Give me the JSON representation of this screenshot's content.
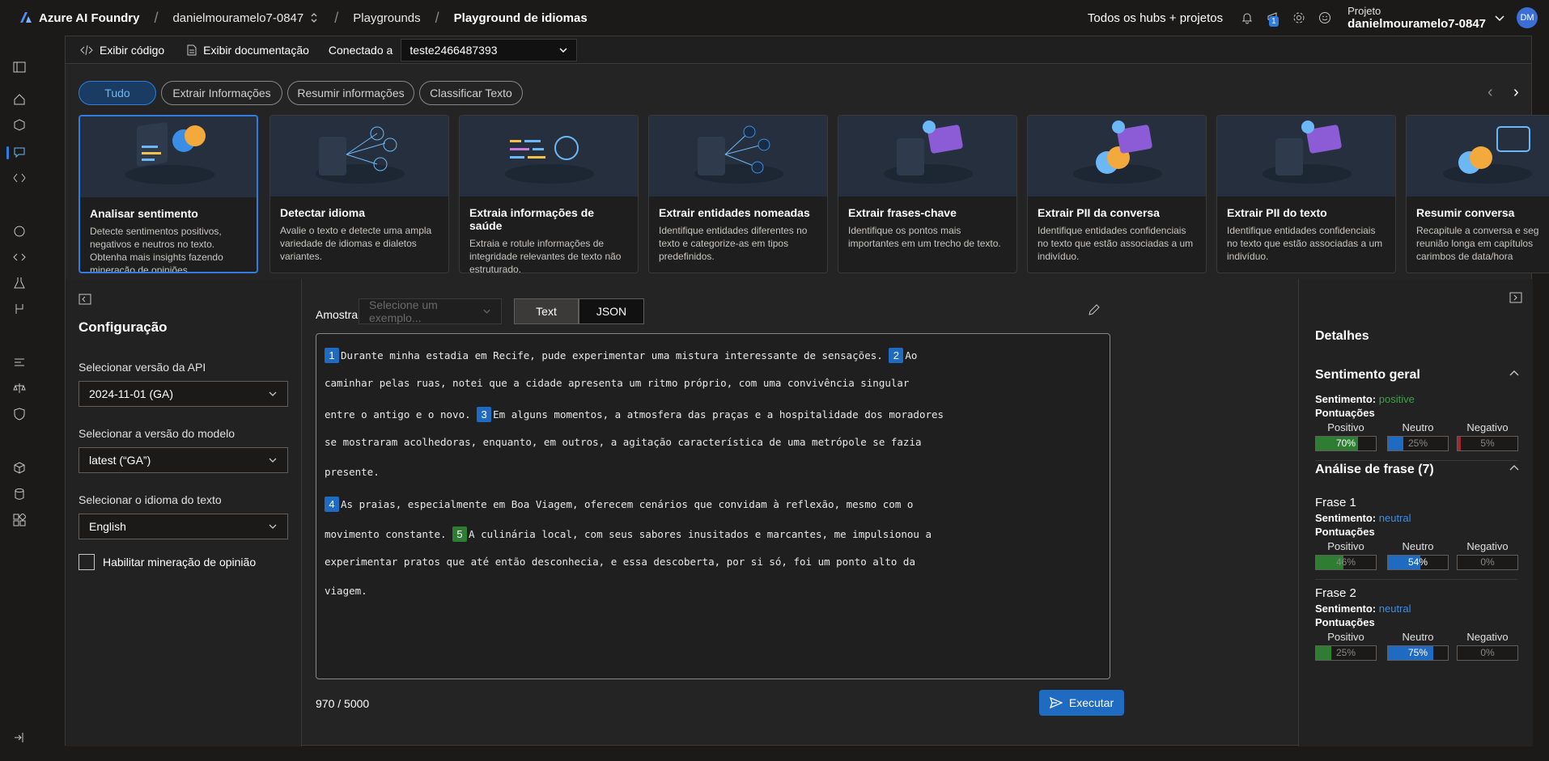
{
  "topbar": {
    "app_name": "Azure AI Foundry",
    "breadcrumb_project": "danielmouramelo7-0847",
    "breadcrumb_playgrounds": "Playgrounds",
    "breadcrumb_current": "Playground de idiomas",
    "all_hubs": "Todos os hubs + projetos",
    "notification_count": "1",
    "project_label": "Projeto",
    "project_name": "danielmouramelo7-0847",
    "avatar_initials": "DM"
  },
  "toolbar": {
    "view_code": "Exibir código",
    "view_docs": "Exibir documentação",
    "connected_to": "Conectado a",
    "connection": "teste2466487393"
  },
  "filters": [
    "Tudo",
    "Extrair Informações",
    "Resumir informações",
    "Classificar Texto"
  ],
  "cards": [
    {
      "title": "Analisar sentimento",
      "desc": "Detecte sentimentos positivos, negativos e neutros no texto. Obtenha mais insights fazendo mineração de opiniões."
    },
    {
      "title": "Detectar idioma",
      "desc": "Avalie o texto e detecte uma ampla variedade de idiomas e dialetos variantes."
    },
    {
      "title": "Extraia informações de saúde",
      "desc": "Extraia e rotule informações de integridade relevantes de texto não estruturado."
    },
    {
      "title": "Extrair entidades nomeadas",
      "desc": "Identifique entidades diferentes no texto e categorize-as em tipos predefinidos."
    },
    {
      "title": "Extrair frases-chave",
      "desc": "Identifique os pontos mais importantes em um trecho de texto."
    },
    {
      "title": "Extrair PII da conversa",
      "desc": "Identifique entidades confidenciais no texto que estão associadas a um indivíduo."
    },
    {
      "title": "Extrair PII do texto",
      "desc": "Identifique entidades confidenciais no texto que estão associadas a um indivíduo."
    },
    {
      "title": "Resumir conversa",
      "desc": "Recapitule a conversa e seg reunião longa em capítulos carimbos de data/hora"
    }
  ],
  "config": {
    "title": "Configuração",
    "api_label": "Selecionar versão da API",
    "api_value": "2024-11-01 (GA)",
    "model_label": "Selecionar a versão do modelo",
    "model_value": "latest (“GA”)",
    "lang_label": "Selecionar o idioma do texto",
    "lang_value": "English",
    "opinion_mining": "Habilitar mineração de opinião"
  },
  "center": {
    "sample_label": "Amostra",
    "sample_placeholder": "Selecione um exemplo...",
    "tab_text": "Text",
    "tab_json": "JSON",
    "lines": [
      {
        "n": "1",
        "text": "Durante minha estadia em Recife, pude experimentar uma mistura interessante de sensações.",
        "n2": "2",
        "text2": "Ao"
      },
      {
        "text": "caminhar pelas ruas, notei que a cidade apresenta um ritmo próprio, com uma convivência singular"
      },
      {
        "text": "entre o antigo e o novo.",
        "n2": "3",
        "text2": "Em alguns momentos, a atmosfera das praças e a hospitalidade dos moradores"
      },
      {
        "text": "se mostraram acolhedoras, enquanto, em outros, a agitação característica de uma metrópole se fazia"
      },
      {
        "text": "presente."
      },
      {
        "n": "4",
        "text": "As praias, especialmente em Boa Viagem, oferecem cenários que convidam à reflexão, mesmo com o"
      },
      {
        "text": "movimento constante.",
        "n2": "5",
        "text2": "A culinária local, com seus sabores inusitados e marcantes, me impulsionou a"
      },
      {
        "text": "experimentar pratos que até então desconhecia, e essa descoberta, por si só, foi um ponto alto da"
      },
      {
        "text": "viagem."
      }
    ],
    "char_count": "970 / 5000",
    "run_label": "Executar"
  },
  "details": {
    "title": "Detalhes",
    "overall_title": "Sentimento geral",
    "sentiment_label": "Sentimento:",
    "scores_label": "Pontuações",
    "col_pos": "Positivo",
    "col_neu": "Neutro",
    "col_neg": "Negativo",
    "overall": {
      "sentiment": "positive",
      "pos": "70%",
      "neu": "25%",
      "neg": "5%",
      "pos_v": 0.7,
      "neu_v": 0.25,
      "neg_v": 0.05
    },
    "phrase_title": "Análise de frase (7)",
    "phrases": [
      {
        "name": "Frase 1",
        "sentiment": "neutral",
        "pos": "46%",
        "neu": "54%",
        "neg": "0%",
        "pos_v": 0.46,
        "neu_v": 0.54,
        "neg_v": 0
      },
      {
        "name": "Frase 2",
        "sentiment": "neutral",
        "pos": "25%",
        "neu": "75%",
        "neg": "0%",
        "pos_v": 0.25,
        "neu_v": 0.75,
        "neg_v": 0
      }
    ]
  },
  "colors": {
    "accent": "#2f7de1",
    "positive": "#2e7d32",
    "neutral": "#1f6bc1",
    "negative": "#a4262c",
    "positive_text": "#3fa14a",
    "neutral_text": "#3a8ee6"
  }
}
